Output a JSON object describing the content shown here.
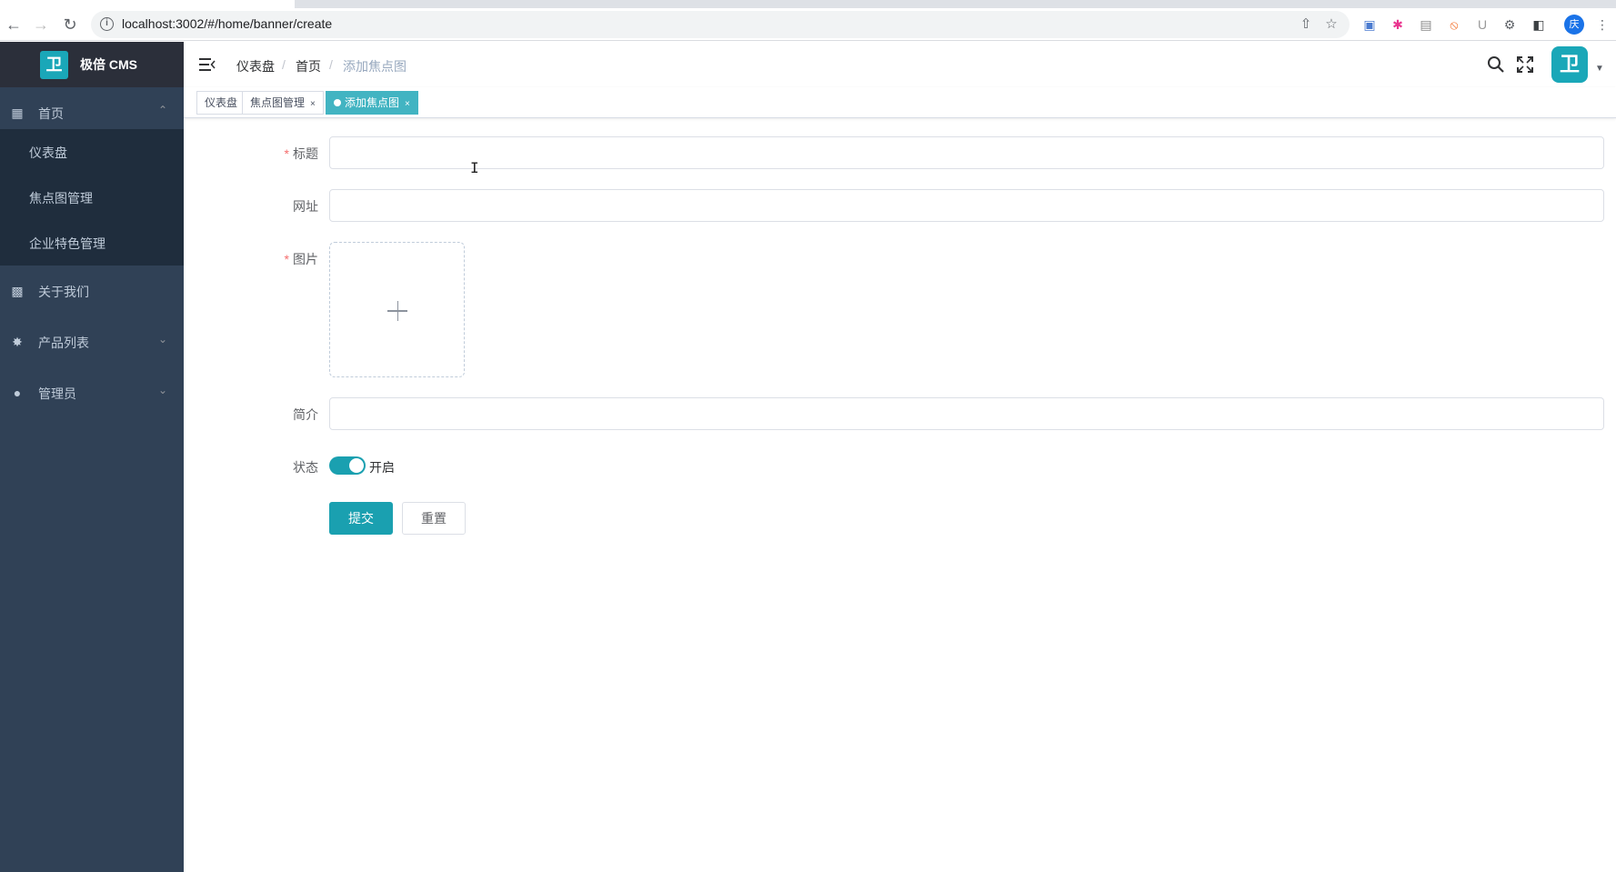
{
  "browser": {
    "url": "localhost:3002/#/home/banner/create",
    "back_icon": "arrow-left-icon",
    "forward_icon": "arrow-right-icon",
    "reload_icon": "reload-icon",
    "profile_initial": "庆"
  },
  "app": {
    "logo_glyph": "卫",
    "title": "极倍 CMS",
    "accent_color": "#1aa0b0",
    "sidebar_bg": "#304156"
  },
  "sidebar": {
    "groups": [
      {
        "label": "首页",
        "icon": "dashboard-grid-icon",
        "arrow": "⌃"
      },
      {
        "label": "关于我们",
        "icon": "document-icon",
        "arrow": ""
      },
      {
        "label": "产品列表",
        "icon": "chart-circle-icon",
        "arrow": "⌄"
      },
      {
        "label": "管理员",
        "icon": "user-icon",
        "arrow": "⌄"
      }
    ],
    "submenu": [
      {
        "label": "仪表盘"
      },
      {
        "label": "焦点图管理"
      },
      {
        "label": "企业特色管理"
      }
    ]
  },
  "header": {
    "breadcrumb": [
      "仪表盘",
      "首页",
      "添加焦点图"
    ],
    "breadcrumb_sep": "/"
  },
  "tags": [
    {
      "label": "仪表盘",
      "closable": false,
      "active": false
    },
    {
      "label": "焦点图管理",
      "closable": true,
      "active": false
    },
    {
      "label": "添加焦点图",
      "closable": true,
      "active": true
    }
  ],
  "form": {
    "title_label": "标题",
    "title_value": "",
    "url_label": "网址",
    "url_value": "",
    "image_label": "图片",
    "intro_label": "简介",
    "intro_value": "",
    "status_label": "状态",
    "status_text": "开启",
    "status_on": true,
    "required_mark": "*",
    "submit_label": "提交",
    "reset_label": "重置"
  }
}
